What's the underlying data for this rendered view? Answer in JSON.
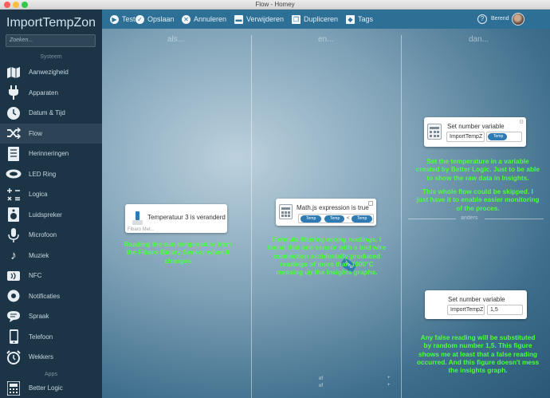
{
  "window": {
    "title": "Flow - Homey"
  },
  "sidebar": {
    "app_title": "ImportTempZon",
    "search_placeholder": "Zoeken...",
    "section_system": "Systeem",
    "section_apps": "Apps",
    "items": [
      {
        "label": "Aanwezigheid",
        "icon": "map-icon"
      },
      {
        "label": "Apparaten",
        "icon": "plug-icon"
      },
      {
        "label": "Datum & Tijd",
        "icon": "clock-icon"
      },
      {
        "label": "Flow",
        "icon": "shuffle-icon"
      },
      {
        "label": "Herinneringen",
        "icon": "list-icon"
      },
      {
        "label": "LED Ring",
        "icon": "led-ring-icon"
      },
      {
        "label": "Logica",
        "icon": "math-icon"
      },
      {
        "label": "Luidspreker",
        "icon": "speaker-icon"
      },
      {
        "label": "Microfoon",
        "icon": "microphone-icon"
      },
      {
        "label": "Muziek",
        "icon": "music-icon"
      },
      {
        "label": "NFC",
        "icon": "nfc-icon"
      },
      {
        "label": "Notificaties",
        "icon": "bell-icon"
      },
      {
        "label": "Spraak",
        "icon": "speech-icon"
      },
      {
        "label": "Telefoon",
        "icon": "phone-icon"
      },
      {
        "label": "Wekkers",
        "icon": "alarm-icon"
      }
    ],
    "apps": [
      {
        "label": "Better Logic",
        "icon": "calculator-icon"
      }
    ]
  },
  "toolbar": {
    "test": "Test",
    "save": "Opslaan",
    "cancel": "Annuleren",
    "delete": "Verwijderen",
    "duplicate": "Dupliceren",
    "tags": "Tags",
    "help": "?",
    "user": "Berend"
  },
  "flow": {
    "columns": [
      "als...",
      "en...",
      "dan..."
    ],
    "anders": "anders",
    "trigger": {
      "title": "Temperatuur 3 is veranderd",
      "subtitle": "Fibaro Met...",
      "tag": "Temp",
      "note": "Reading the sun temperature from the Fibaro Binary Sensor when it changes"
    },
    "condition": {
      "title": "Math.js expression is true",
      "tokens": [
        "Temp",
        "Temp",
        "Temp"
      ],
      "operator": "<",
      "note": "Formula filtering wrong readings. I found that one sensor with a bad wire connection accidentally produced readings of more than 1000°C messing up the Insights graphs."
    },
    "action_then": {
      "title": "Set number variable",
      "variable": "ImportTempZ",
      "value_token": "Temp",
      "note_1": "Set the temperature in a variable created by Better Logic. Just to be able to show the raw data in Insights.",
      "note_2": "This whole flow could be skipped. I just have it to enable easier monitoring of the proces."
    },
    "action_else": {
      "title": "Set number variable",
      "variable": "ImportTempZ",
      "value": "1,5",
      "note": "Any false reading will be substituted by random number 1,5. This figure shows me at least that a false reading occurred. And this figure doesn't mess the insights graph."
    },
    "bottom_marks": {
      "or": "of",
      "plus": "+"
    }
  },
  "colors": {
    "toolbar": "#2d6f95",
    "sidebar": "#1b3547",
    "note": "#4dff3c",
    "pill": "#2e7bb3"
  }
}
